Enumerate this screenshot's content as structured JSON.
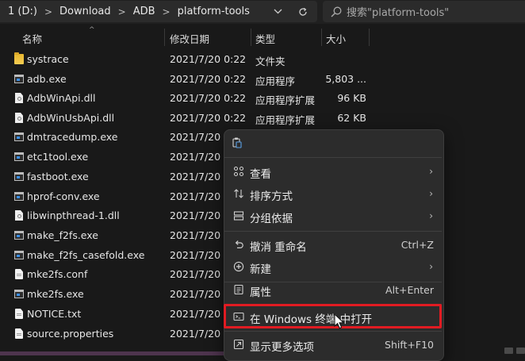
{
  "address": {
    "crumbs": [
      "1 (D:)",
      "Download",
      "ADB",
      "platform-tools"
    ],
    "separator": ">"
  },
  "search": {
    "placeholder": "搜索\"platform-tools\""
  },
  "columns": {
    "name": "名称",
    "modified": "修改日期",
    "type": "类型",
    "size": "大小"
  },
  "files": [
    {
      "name": "systrace",
      "date": "2021/7/20 0:22",
      "type": "文件夹",
      "size": "",
      "icon": "folder-icon"
    },
    {
      "name": "adb.exe",
      "date": "2021/7/20 0:22",
      "type": "应用程序",
      "size": "5,803 ...",
      "icon": "exe-icon"
    },
    {
      "name": "AdbWinApi.dll",
      "date": "2021/7/20 0:22",
      "type": "应用程序扩展",
      "size": "96 KB",
      "icon": "dll-icon"
    },
    {
      "name": "AdbWinUsbApi.dll",
      "date": "2021/7/20 0:22",
      "type": "应用程序扩展",
      "size": "62 KB",
      "icon": "dll-icon"
    },
    {
      "name": "dmtracedump.exe",
      "date": "2021/7/20",
      "type": "",
      "size": "",
      "icon": "exe-icon"
    },
    {
      "name": "etc1tool.exe",
      "date": "2021/7/20",
      "type": "",
      "size": "",
      "icon": "exe-icon"
    },
    {
      "name": "fastboot.exe",
      "date": "2021/7/20",
      "type": "",
      "size": "",
      "icon": "exe-icon"
    },
    {
      "name": "hprof-conv.exe",
      "date": "2021/7/20",
      "type": "",
      "size": "",
      "icon": "exe-icon"
    },
    {
      "name": "libwinpthread-1.dll",
      "date": "2021/7/20",
      "type": "",
      "size": "",
      "icon": "dll-icon"
    },
    {
      "name": "make_f2fs.exe",
      "date": "2021/7/20",
      "type": "",
      "size": "",
      "icon": "exe-icon"
    },
    {
      "name": "make_f2fs_casefold.exe",
      "date": "2021/7/20",
      "type": "",
      "size": "",
      "icon": "exe-icon"
    },
    {
      "name": "mke2fs.conf",
      "date": "2021/7/20",
      "type": "",
      "size": "",
      "icon": "doc-icon"
    },
    {
      "name": "mke2fs.exe",
      "date": "2021/7/20",
      "type": "",
      "size": "",
      "icon": "exe-icon"
    },
    {
      "name": "NOTICE.txt",
      "date": "2021/7/20",
      "type": "",
      "size": "",
      "icon": "doc-icon"
    },
    {
      "name": "source.properties",
      "date": "2021/7/20",
      "type": "",
      "size": "",
      "icon": "doc-icon"
    }
  ],
  "context_menu": {
    "items": [
      {
        "label": "查看",
        "shortcut": "",
        "submenu": true,
        "icon": "view-grid-icon"
      },
      {
        "label": "排序方式",
        "shortcut": "",
        "submenu": true,
        "icon": "sort-icon"
      },
      {
        "label": "分组依据",
        "shortcut": "",
        "submenu": true,
        "icon": "group-icon"
      },
      {
        "label": "撤消 重命名",
        "shortcut": "Ctrl+Z",
        "submenu": false,
        "icon": "undo-icon"
      },
      {
        "label": "新建",
        "shortcut": "",
        "submenu": true,
        "icon": "new-icon"
      },
      {
        "label": "属性",
        "shortcut": "Alt+Enter",
        "submenu": false,
        "icon": "properties-icon"
      },
      {
        "label": "在 Windows 终端 中打开",
        "shortcut": "",
        "submenu": false,
        "icon": "terminal-icon"
      },
      {
        "label": "显示更多选项",
        "shortcut": "Shift+F10",
        "submenu": false,
        "icon": "more-options-icon"
      }
    ],
    "highlighted": "在 Windows 终端 中打开"
  },
  "colors": {
    "background": "#191919",
    "menu": "#2c2c2c",
    "highlight_border": "#e11b22",
    "folder": "#f4cc52"
  }
}
